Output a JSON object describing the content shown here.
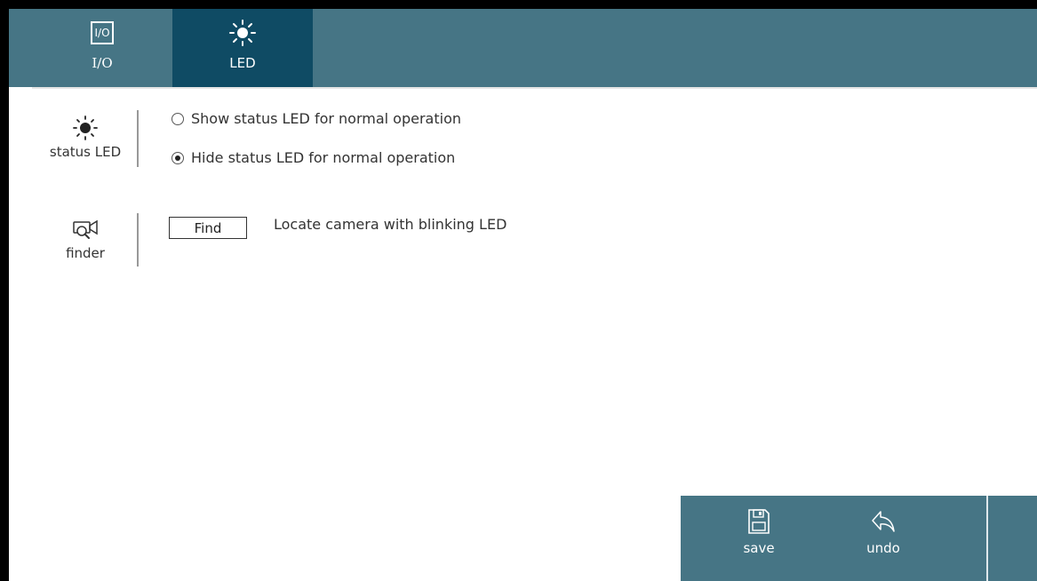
{
  "tabs": [
    {
      "label": "I/O",
      "icon": "io-icon",
      "icon_text": "I/O",
      "active": false
    },
    {
      "label": "LED",
      "icon": "sun-icon",
      "active": true
    }
  ],
  "status_led": {
    "label": "status LED",
    "icon": "sun-icon",
    "options": [
      {
        "label": "Show status LED for normal operation",
        "checked": false
      },
      {
        "label": "Hide status LED for normal operation",
        "checked": true
      }
    ]
  },
  "finder": {
    "label": "finder",
    "icon": "camera-search-icon",
    "button_label": "Find",
    "description": "Locate camera with blinking LED"
  },
  "footer": {
    "save_label": "save",
    "undo_label": "undo"
  },
  "colors": {
    "bar": "#467585",
    "active_tab": "#0f4b64",
    "text": "#333333",
    "background": "#ffffff"
  }
}
